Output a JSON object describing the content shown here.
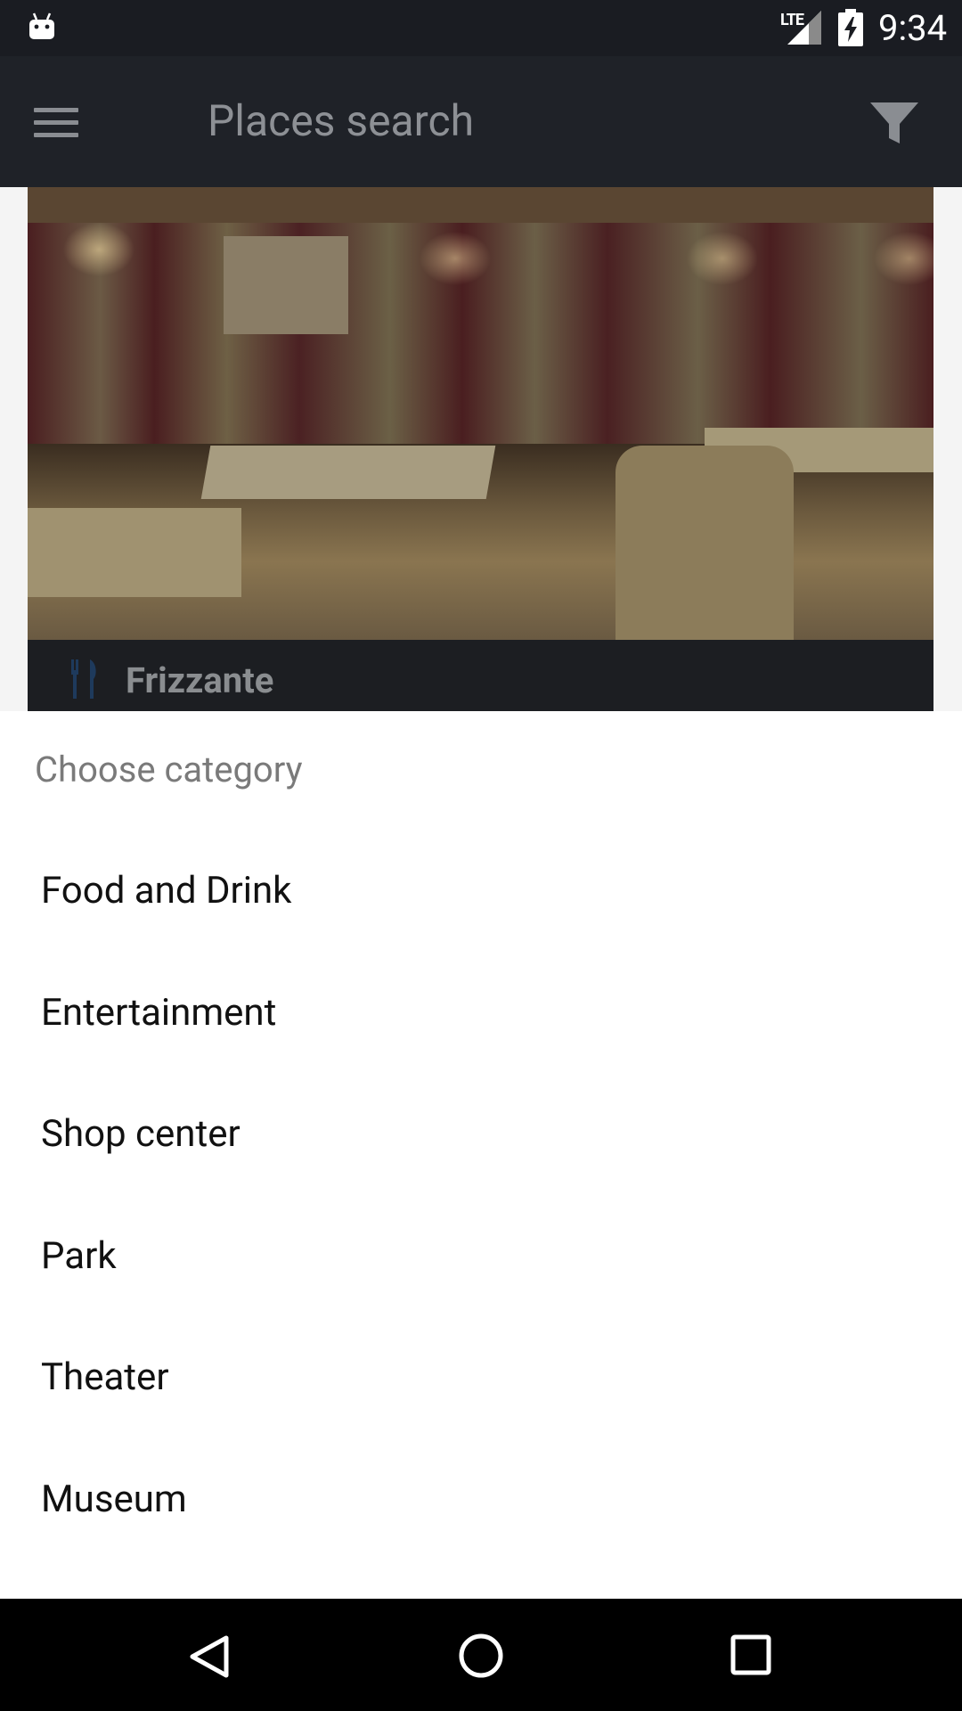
{
  "status_bar": {
    "network": "LTE",
    "time": "9:34"
  },
  "toolbar": {
    "title": "Places search"
  },
  "place_card": {
    "name": "Frizzante"
  },
  "sheet": {
    "title": "Choose category",
    "categories": [
      {
        "label": "Food and Drink"
      },
      {
        "label": "Entertainment"
      },
      {
        "label": "Shop center"
      },
      {
        "label": "Park"
      },
      {
        "label": "Theater"
      },
      {
        "label": "Museum"
      }
    ]
  },
  "colors": {
    "status_bar_bg": "#1a1c22",
    "toolbar_bg": "#1f2228",
    "sheet_bg": "#ffffff",
    "nav_bar_bg": "#000000",
    "accent_icon": "#1e3a5c"
  },
  "icons": {
    "status": [
      "android-icon",
      "signal-icon",
      "battery-charging-icon"
    ],
    "toolbar": [
      "menu-icon",
      "filter-icon"
    ],
    "card": [
      "cutlery-icon"
    ],
    "nav": [
      "back-icon",
      "home-icon",
      "recent-apps-icon"
    ]
  }
}
